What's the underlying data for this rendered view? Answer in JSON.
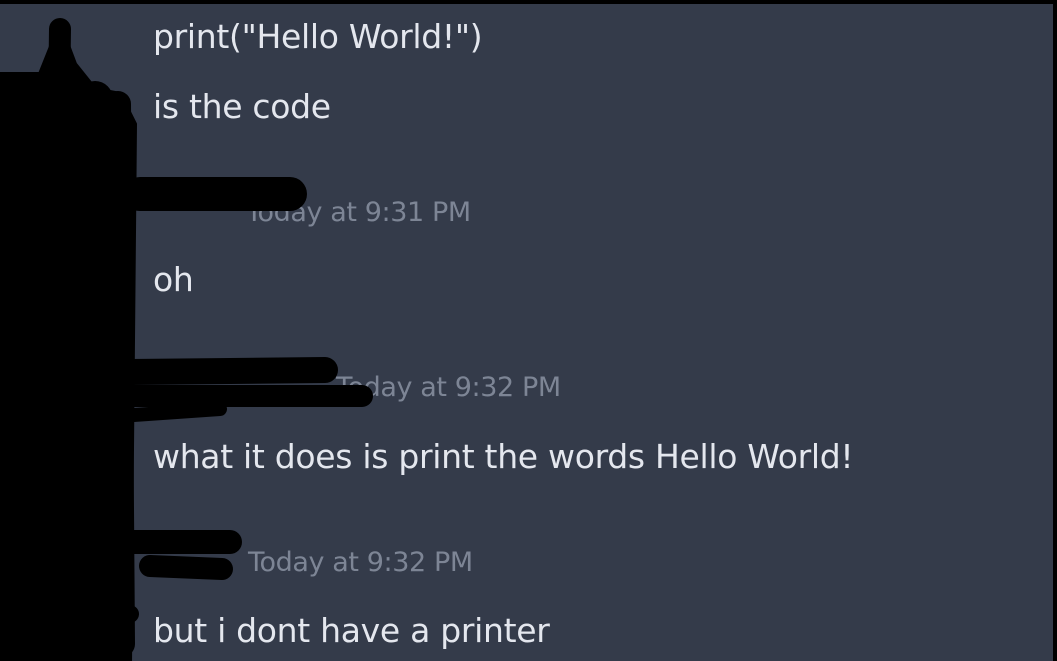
{
  "messages": [
    {
      "text": "print(\"Hello World!\")"
    },
    {
      "text": "is the code"
    },
    {
      "timestamp": "Today at 9:31 PM",
      "text": "oh"
    },
    {
      "timestamp": "Today at 9:32 PM",
      "text": "what it does is print the words Hello World!"
    },
    {
      "timestamp": "Today at 9:32 PM",
      "text": "but i dont have a printer"
    }
  ],
  "colors": {
    "background": "#343b4a",
    "message_text": "#e4e7ee",
    "timestamp_text": "#7d8595",
    "redaction": "#000000"
  }
}
